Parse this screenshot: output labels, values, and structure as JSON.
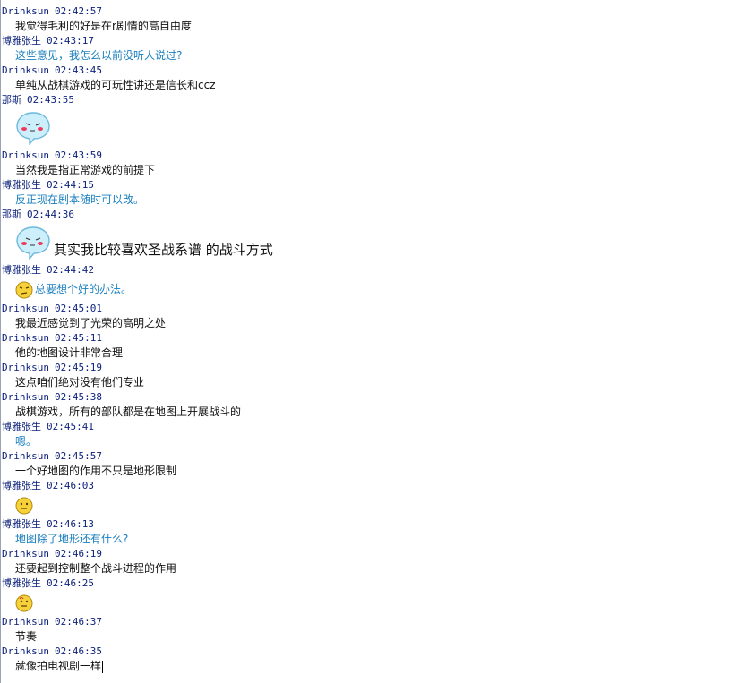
{
  "messages": [
    {
      "sender": "Drinksun",
      "time": "02:42:57",
      "text": "我觉得毛利的好是在r剧情的高自由度"
    },
    {
      "sender": "博雅张生",
      "time": "02:43:17",
      "text": "这些意见，我怎么以前没听人说过?"
    },
    {
      "sender": "Drinksun",
      "time": "02:43:45",
      "text": "单纯从战棋游戏的可玩性讲还是信长和ccz"
    },
    {
      "sender": "那斯",
      "time": "02:43:55",
      "text": ""
    },
    {
      "sender": "Drinksun",
      "time": "02:43:59",
      "text": "当然我是指正常游戏的前提下"
    },
    {
      "sender": "博雅张生",
      "time": "02:44:15",
      "text": "反正现在剧本随时可以改。"
    },
    {
      "sender": "那斯",
      "time": "02:44:36",
      "text": "其实我比较喜欢圣战系谱 的战斗方式"
    },
    {
      "sender": "博雅张生",
      "time": "02:44:42",
      "text": "总要想个好的办法。"
    },
    {
      "sender": "Drinksun",
      "time": "02:45:01",
      "text": "我最近感觉到了光荣的高明之处"
    },
    {
      "sender": "Drinksun",
      "time": "02:45:11",
      "text": "他的地图设计非常合理"
    },
    {
      "sender": "Drinksun",
      "time": "02:45:19",
      "text": "这点咱们绝对没有他们专业"
    },
    {
      "sender": "Drinksun",
      "time": "02:45:38",
      "text": "战棋游戏，所有的部队都是在地图上开展战斗的"
    },
    {
      "sender": "博雅张生",
      "time": "02:45:41",
      "text": "嗯。"
    },
    {
      "sender": "Drinksun",
      "time": "02:45:57",
      "text": "一个好地图的作用不只是地形限制"
    },
    {
      "sender": "博雅张生",
      "time": "02:46:03",
      "text": ""
    },
    {
      "sender": "博雅张生",
      "time": "02:46:13",
      "text": "地图除了地形还有什么?"
    },
    {
      "sender": "Drinksun",
      "time": "02:46:19",
      "text": "还要起到控制整个战斗进程的作用"
    },
    {
      "sender": "博雅张生",
      "time": "02:46:25",
      "text": ""
    },
    {
      "sender": "Drinksun",
      "time": "02:46:37",
      "text": "节奏"
    },
    {
      "sender": "Drinksun",
      "time": "02:46:35",
      "text": "就像拍电视剧一样"
    }
  ],
  "icons": {
    "bubble": "speech-bubble-face-icon",
    "smiley_thinking": "thinking-smiley-icon",
    "smiley_puzzled": "puzzled-smiley-icon"
  },
  "colors": {
    "header": "#0a1f7a",
    "self_text": "#1a7fbf",
    "other_text": "#111111"
  }
}
